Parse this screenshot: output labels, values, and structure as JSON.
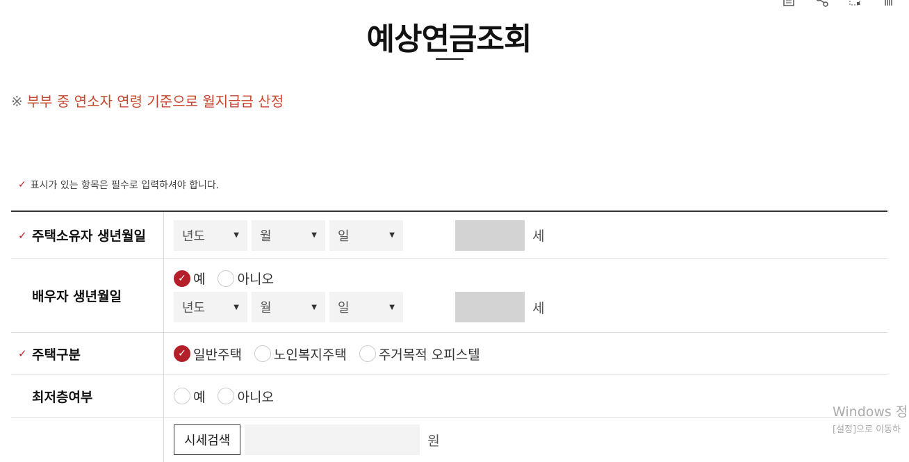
{
  "page": {
    "title": "예상연금조회",
    "notice_mark": "※",
    "notice": "부부 중 연소자 연령 기준으로 월지급금 산정",
    "required_note": "표시가 있는 항목은 필수로 입력하셔야 합니다."
  },
  "top_icons": [
    "print-icon",
    "share-icon",
    "qr-icon",
    "hand-icon"
  ],
  "form": {
    "owner_birth": {
      "label": "주택소유자 생년월일",
      "required": true,
      "year": "년도",
      "month": "월",
      "day": "일",
      "age_unit": "세"
    },
    "spouse_birth": {
      "label": "배우자 생년월일",
      "required": false,
      "options": [
        {
          "label": "예",
          "checked": true
        },
        {
          "label": "아니오",
          "checked": false
        }
      ],
      "year": "년도",
      "month": "월",
      "day": "일",
      "age_unit": "세"
    },
    "house_type": {
      "label": "주택구분",
      "required": true,
      "options": [
        {
          "label": "일반주택",
          "checked": true
        },
        {
          "label": "노인복지주택",
          "checked": false
        },
        {
          "label": "주거목적 오피스텔",
          "checked": false
        }
      ]
    },
    "lowest_floor": {
      "label": "최저층여부",
      "required": false,
      "options": [
        {
          "label": "예",
          "checked": false
        },
        {
          "label": "아니오",
          "checked": false
        }
      ]
    },
    "price": {
      "search_button": "시세검색",
      "unit": "원"
    }
  },
  "watermark": {
    "line1": "Windows 정",
    "line2": "[설정]으로 이동하"
  },
  "colors": {
    "accent": "#b41f29",
    "notice": "#c8462b"
  }
}
